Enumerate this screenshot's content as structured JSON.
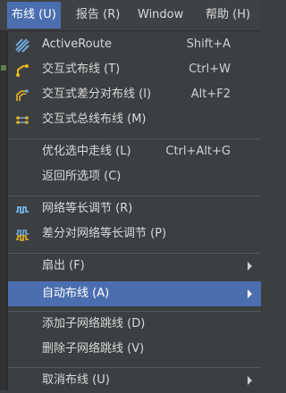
{
  "menubar": {
    "items": [
      "布线 (U)",
      "报告 (R)",
      "Window",
      "帮助 (H)"
    ]
  },
  "menu": {
    "items": [
      {
        "label": "ActiveRoute",
        "shortcut": "Shift+A",
        "icon": "active-route-icon"
      },
      {
        "label": "交互式布线 (T)",
        "shortcut": "Ctrl+W",
        "icon": "interactive-route-icon"
      },
      {
        "label": "交互式差分对布线 (I)",
        "shortcut": "Alt+F2",
        "icon": "diff-pair-route-icon"
      },
      {
        "label": "交互式总线布线 (M)",
        "shortcut": "",
        "icon": "bus-route-icon"
      },
      {
        "label": "优化选中走线 (L)",
        "shortcut": "Ctrl+Alt+G"
      },
      {
        "label": "返回所选项 (C)",
        "shortcut": ""
      },
      {
        "label": "网络等长调节 (R)",
        "shortcut": "",
        "icon": "length-tuning-icon"
      },
      {
        "label": "差分对网络等长调节 (P)",
        "shortcut": "",
        "icon": "diff-pair-length-tuning-icon"
      },
      {
        "label": "扇出 (F)",
        "shortcut": ""
      },
      {
        "label": "自动布线 (A)",
        "shortcut": ""
      },
      {
        "label": "添加子网络跳线 (D)",
        "shortcut": ""
      },
      {
        "label": "删除子网络跳线 (V)",
        "shortcut": ""
      },
      {
        "label": "取消布线 (U)",
        "shortcut": ""
      }
    ]
  },
  "colors": {
    "menu_bg": "#3c3f41",
    "highlight": "#4b6eaf",
    "text": "#d8d8d8",
    "icon_yellow": "#e6b422",
    "icon_blue": "#6fa8dc"
  }
}
